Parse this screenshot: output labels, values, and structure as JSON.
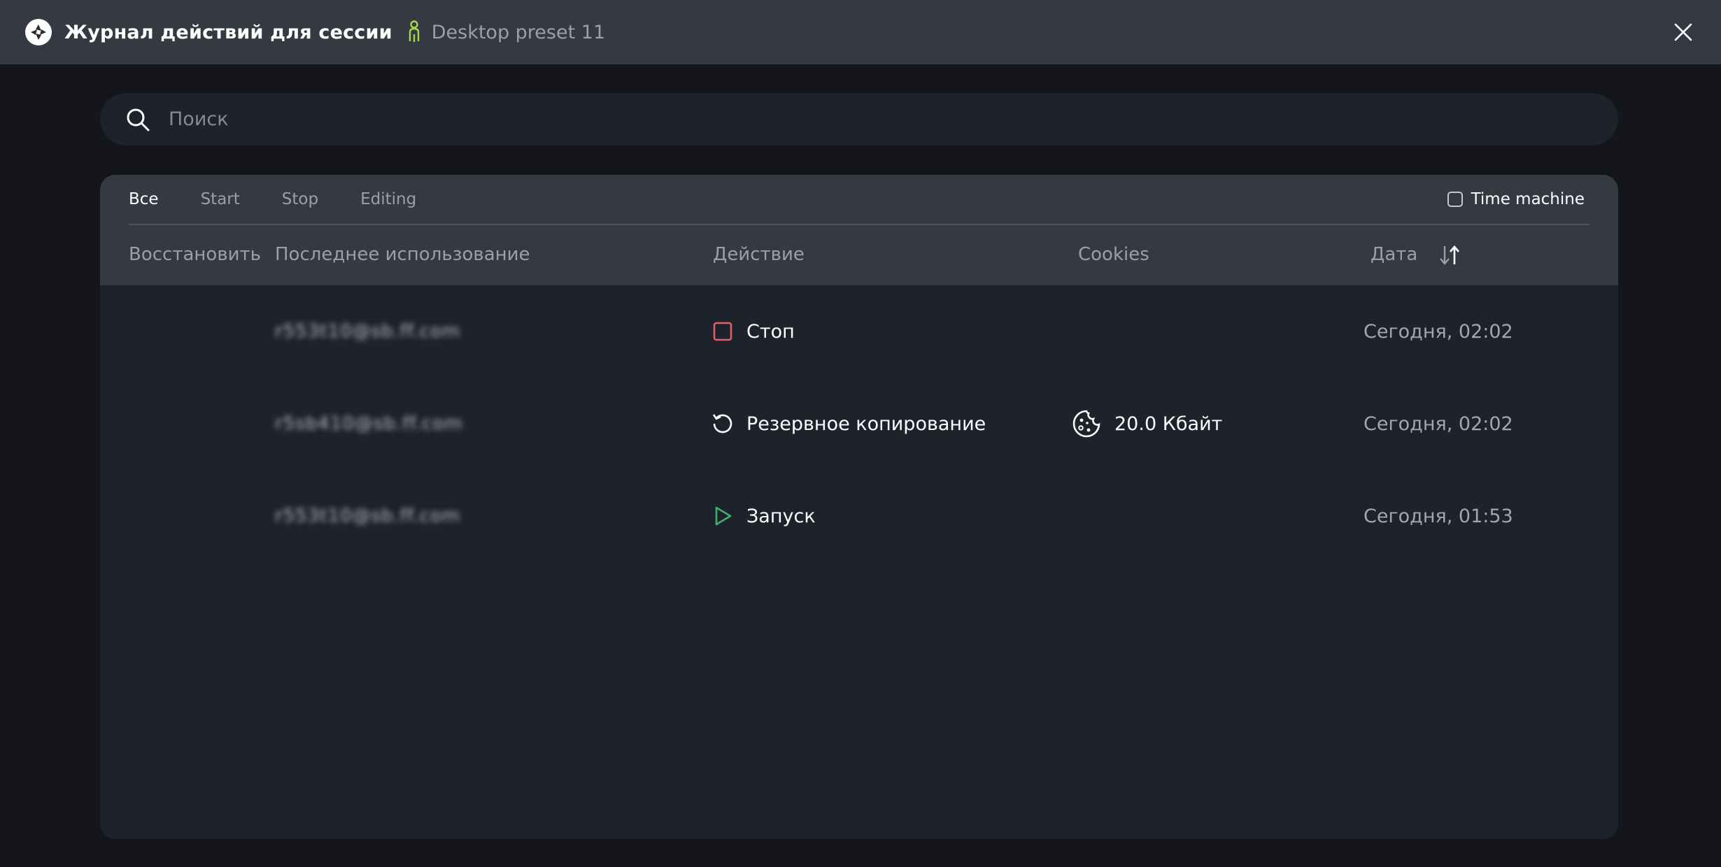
{
  "window": {
    "title": "Журнал действий для сессии",
    "profile_name": "Desktop preset 11"
  },
  "search": {
    "placeholder": "Поиск"
  },
  "tabs": [
    {
      "label": "Все",
      "active": true
    },
    {
      "label": "Start",
      "active": false
    },
    {
      "label": "Stop",
      "active": false
    },
    {
      "label": "Editing",
      "active": false
    }
  ],
  "time_machine": {
    "label": "Time machine",
    "checked": false
  },
  "table": {
    "columns": {
      "restore": "Восстановить",
      "last_used": "Последнее использование",
      "action": "Действие",
      "cookies": "Cookies",
      "date": "Дата"
    },
    "rows": [
      {
        "last_used": "r553t10@sb.ff.com",
        "action": "Стоп",
        "action_icon": "stop-square-icon",
        "cookies": "",
        "date": "Сегодня, 02:02"
      },
      {
        "last_used": "r5sb410@sb.ff.com",
        "action": "Резервное копирование",
        "action_icon": "backup-rotate-icon",
        "cookies": "20.0 Кбайт",
        "date": "Сегодня, 02:02"
      },
      {
        "last_used": "r553t10@sb.ff.com",
        "action": "Запуск",
        "action_icon": "play-icon",
        "cookies": "",
        "date": "Сегодня, 01:53"
      }
    ]
  },
  "colors": {
    "titlebar_bg": "#353a42",
    "page_bg": "#14161b",
    "panel_bg": "#1e222a",
    "stop_red": "#e0606a",
    "play_green": "#3fae6f",
    "profile_green": "#a6d64a"
  },
  "icons": {
    "app_logo": "aperture-logo-icon",
    "profile": "person-icon",
    "close": "close-icon",
    "search": "search-icon",
    "sort": "sort-arrows-icon",
    "cookie": "cookie-icon"
  }
}
